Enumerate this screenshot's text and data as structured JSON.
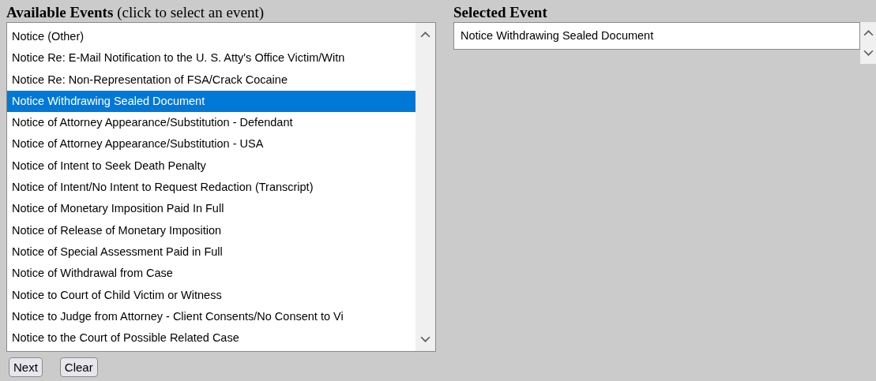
{
  "available_events": {
    "heading": "Available Events",
    "hint": "(click to select an event)",
    "items": [
      {
        "label": "Notice (Other)",
        "selected": false
      },
      {
        "label": "Notice Re: E-Mail Notification to the U. S. Atty's Office Victim/Witn",
        "selected": false
      },
      {
        "label": "Notice Re: Non-Representation of FSA/Crack Cocaine",
        "selected": false
      },
      {
        "label": "Notice Withdrawing Sealed Document",
        "selected": true
      },
      {
        "label": "Notice of Attorney Appearance/Substitution - Defendant",
        "selected": false
      },
      {
        "label": "Notice of Attorney Appearance/Substitution - USA",
        "selected": false
      },
      {
        "label": "Notice of Intent to Seek Death Penalty",
        "selected": false
      },
      {
        "label": "Notice of Intent/No Intent to Request Redaction (Transcript)",
        "selected": false
      },
      {
        "label": "Notice of Monetary Imposition Paid In Full",
        "selected": false
      },
      {
        "label": "Notice of Release of Monetary Imposition",
        "selected": false
      },
      {
        "label": "Notice of Special Assessment Paid in Full",
        "selected": false
      },
      {
        "label": "Notice of Withdrawal from Case",
        "selected": false
      },
      {
        "label": "Notice to Court of Child Victim or Witness",
        "selected": false
      },
      {
        "label": "Notice to Judge from Attorney - Client Consents/No Consent to Vi",
        "selected": false
      },
      {
        "label": "Notice to the Court of Possible Related Case",
        "selected": false
      }
    ]
  },
  "selected_event": {
    "heading": "Selected Event",
    "items": [
      "Notice Withdrawing Sealed Document"
    ]
  },
  "buttons": [
    "Next",
    "Clear"
  ]
}
